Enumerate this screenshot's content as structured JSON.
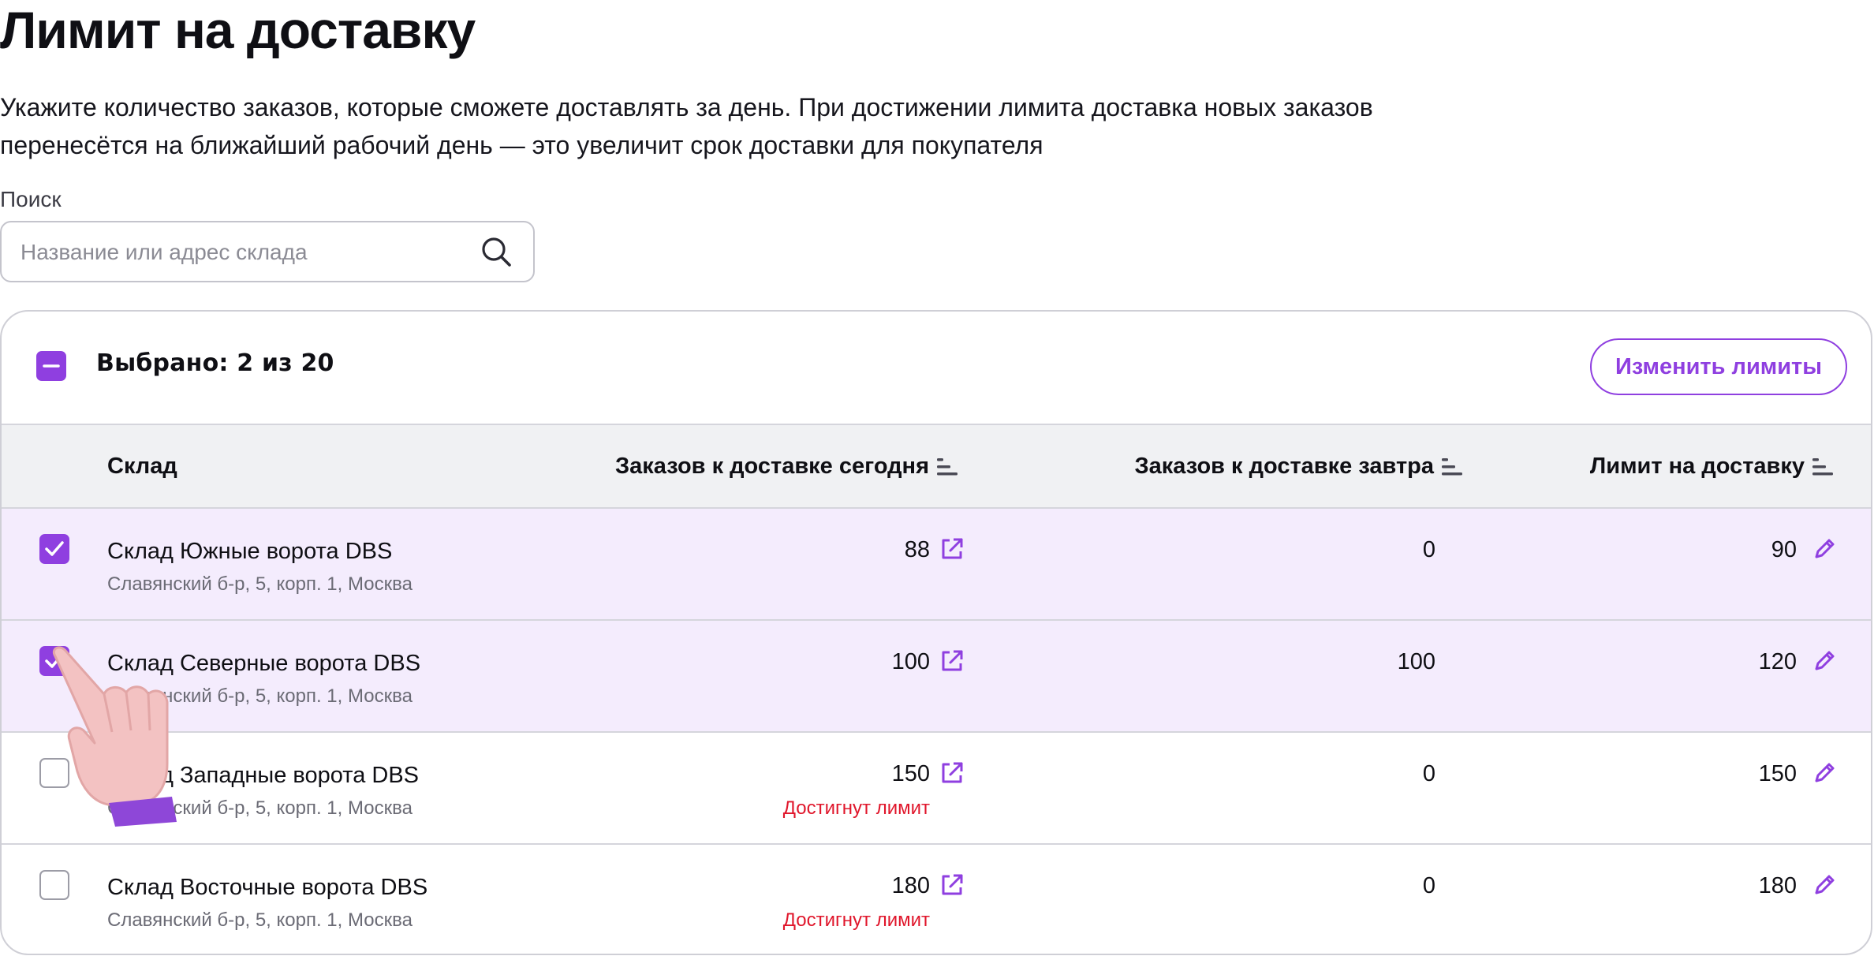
{
  "page": {
    "title": "Лимит на доставку",
    "subtitle": "Укажите количество заказов, которые сможете доставлять за день. При достижении лимита доставка новых заказов перенесётся на ближайший рабочий день — это увеличит срок доставки для покупателя"
  },
  "search": {
    "label": "Поиск",
    "placeholder": "Название или адрес склада",
    "value": ""
  },
  "toolbar": {
    "selected_text": "Выбрано: 2 из 20",
    "change_limits_label": "Изменить лимиты"
  },
  "table": {
    "headers": {
      "warehouse": "Склад",
      "today": "Заказов к доставке сегодня",
      "tomorrow": "Заказов к доставке завтра",
      "limit": "Лимит на доставку"
    },
    "rows": [
      {
        "checked": true,
        "name": "Склад Южные ворота DBS",
        "address": "Славянский б-р, 5, корп. 1, Москва",
        "today": "88",
        "warning": "",
        "tomorrow": "0",
        "limit": "90"
      },
      {
        "checked": true,
        "name": "Склад Северные ворота DBS",
        "address": "Славянский б-р, 5, корп. 1, Москва",
        "today": "100",
        "warning": "",
        "tomorrow": "100",
        "limit": "120"
      },
      {
        "checked": false,
        "name": "Склад Западные ворота DBS",
        "address": "Славянский б-р, 5, корп. 1, Москва",
        "today": "150",
        "warning": "Достигнут лимит",
        "tomorrow": "0",
        "limit": "150"
      },
      {
        "checked": false,
        "name": "Склад Восточные ворота DBS",
        "address": "Славянский б-р, 5, корп. 1, Москва",
        "today": "180",
        "warning": "Достигнут лимит",
        "tomorrow": "0",
        "limit": "180"
      }
    ]
  },
  "icons": {
    "search": "search-icon",
    "sort": "sort-icon",
    "open": "external-link-icon",
    "edit": "pencil-icon",
    "cursor": "pointing-hand-cursor"
  },
  "colors": {
    "accent": "#8f3fe0",
    "selected_row": "#f4ecfd",
    "warning": "#e0162b",
    "header_bg": "#f0f1f3"
  }
}
